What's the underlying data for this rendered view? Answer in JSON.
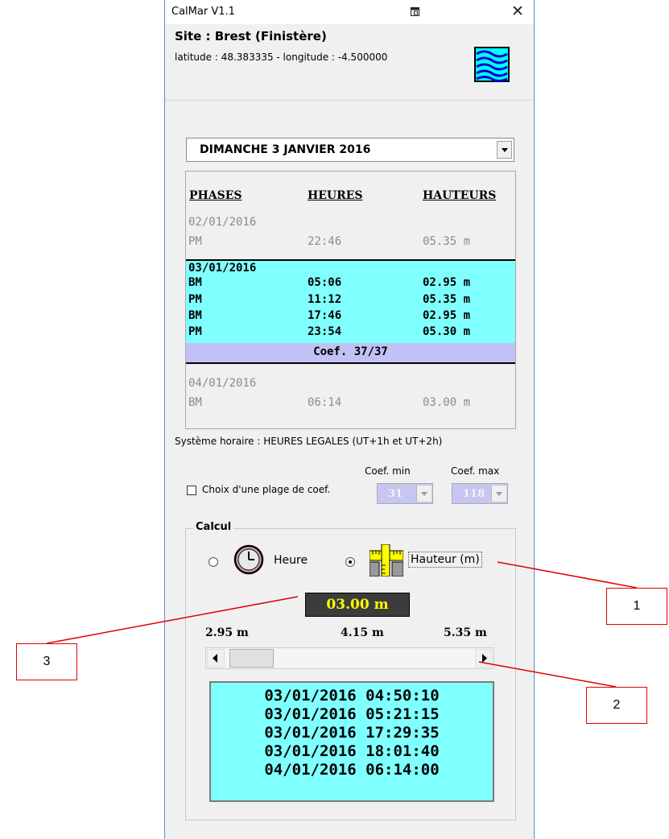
{
  "window": {
    "title": "CalMar V1.1"
  },
  "site": {
    "title": "Site : Brest (Finistère)",
    "coords": "latitude : 48.383335 - longitude : -4.500000"
  },
  "date_select": {
    "value": "DIMANCHE 3 JANVIER 2016"
  },
  "tide_table": {
    "headers": {
      "phases": "PHASES",
      "heures": "HEURES",
      "hauteurs": "HAUTEURS"
    },
    "prev": {
      "date": "02/01/2016",
      "phase": "PM",
      "heure": "22:46",
      "hauteur": "05.35 m"
    },
    "today": {
      "date": "03/01/2016",
      "rows": [
        {
          "phase": "BM",
          "heure": "05:06",
          "hauteur": "02.95 m"
        },
        {
          "phase": "PM",
          "heure": "11:12",
          "hauteur": "05.35 m"
        },
        {
          "phase": "BM",
          "heure": "17:46",
          "hauteur": "02.95 m"
        },
        {
          "phase": "PM",
          "heure": "23:54",
          "hauteur": "05.30 m"
        }
      ],
      "coef": "Coef. 37/37"
    },
    "next": {
      "date": "04/01/2016",
      "phase": "BM",
      "heure": "06:14",
      "hauteur": "03.00 m"
    }
  },
  "systeme": "Système horaire : HEURES LEGALES (UT+1h et UT+2h)",
  "coef_range": {
    "checkbox_label": "Choix d'une plage de coef.",
    "min_label": "Coef. min",
    "max_label": "Coef. max",
    "min_value": "31",
    "max_value": "118"
  },
  "calcul": {
    "title": "Calcul",
    "heure_label": "Heure",
    "hauteur_label": "Hauteur (m)",
    "selected": "hauteur",
    "value": "03.00 m",
    "scale_min": "2.95 m",
    "scale_mid": "4.15 m",
    "scale_max": "5.35 m",
    "slider_fraction": 0.02,
    "results": [
      "03/01/2016 04:50:10",
      "03/01/2016 05:21:15",
      "03/01/2016 17:29:35",
      "03/01/2016 18:01:40",
      "04/01/2016 06:14:00"
    ]
  },
  "callouts": {
    "c1": "1",
    "c2": "2",
    "c3": "3"
  },
  "colors": {
    "today_bg": "#80ffff",
    "coef_bg": "#c1c1f5",
    "value_text": "#ffff00",
    "callout_border": "#e00000"
  }
}
